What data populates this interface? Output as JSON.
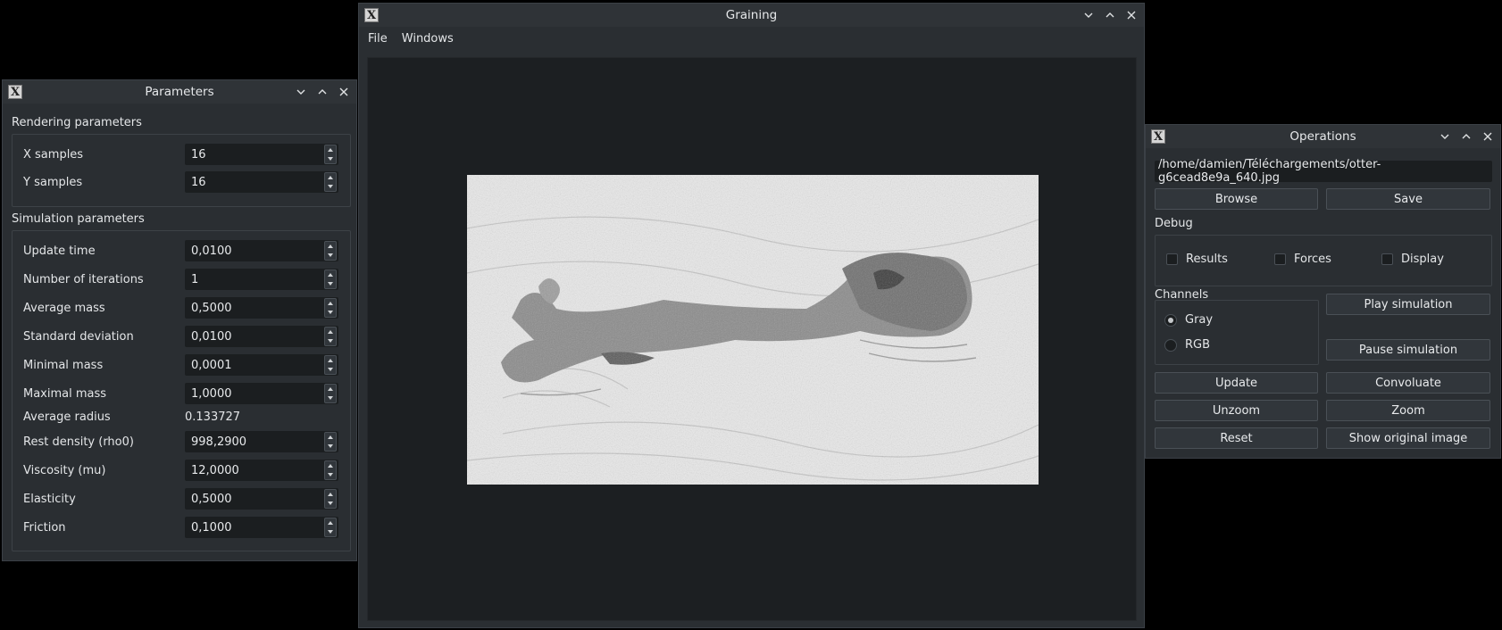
{
  "parameters_window": {
    "title": "Parameters",
    "rendering_section": "Rendering parameters",
    "rendering": [
      {
        "label": "X samples",
        "value": "16"
      },
      {
        "label": "Y samples",
        "value": "16"
      }
    ],
    "simulation_section": "Simulation parameters",
    "simulation": [
      {
        "label": "Update time",
        "value": "0,0100"
      },
      {
        "label": "Number of iterations",
        "value": "1"
      },
      {
        "label": "Average mass",
        "value": "0,5000"
      },
      {
        "label": "Standard deviation",
        "value": "0,0100"
      },
      {
        "label": "Minimal mass",
        "value": "0,0001"
      },
      {
        "label": "Maximal mass",
        "value": "1,0000"
      },
      {
        "label": "Average radius",
        "value": "0.133727"
      },
      {
        "label": "Rest density (rho0)",
        "value": "998,2900"
      },
      {
        "label": "Viscosity (mu)",
        "value": "12,0000"
      },
      {
        "label": "Elasticity",
        "value": "0,5000"
      },
      {
        "label": "Friction",
        "value": "0,1000"
      }
    ]
  },
  "graining_window": {
    "title": "Graining",
    "menu": [
      "File",
      "Windows"
    ]
  },
  "operations_window": {
    "title": "Operations",
    "path": "/home/damien/Téléchargements/otter-g6cead8e9a_640.jpg",
    "browse": "Browse",
    "save": "Save",
    "debug_section": "Debug",
    "debug": [
      "Results",
      "Forces",
      "Display"
    ],
    "channels_section": "Channels",
    "channels": [
      "Gray",
      "RGB"
    ],
    "selected_channel": "Gray",
    "play": "Play simulation",
    "pause": "Pause simulation",
    "update": "Update",
    "convoluate": "Convoluate",
    "unzoom": "Unzoom",
    "zoom": "Zoom",
    "reset": "Reset",
    "show_original": "Show original image"
  },
  "colors": {
    "window_bg": "#2a2e32",
    "field_bg": "#1b1e20",
    "button_bg": "#31363b",
    "text": "#e4e6e8"
  }
}
